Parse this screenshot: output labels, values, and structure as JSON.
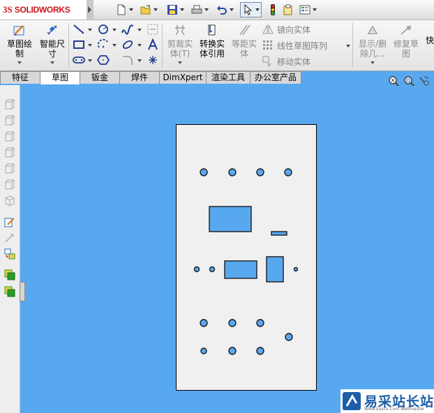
{
  "app": {
    "brand": "SOLIDWORKS",
    "brand_prefix": "3S"
  },
  "command_manager": {
    "sketch_label": "草图绘\n制",
    "smart_dim_label": "智能尺\n寸",
    "trim_label": "剪裁实\n体(T)",
    "convert_label": "转换实\n体引用",
    "offset_label": "等距实\n体",
    "mirror_label": "镜向实体",
    "linear_pattern_label": "线性草图阵列",
    "move_label": "移动实体",
    "show_delete_label": "显示/删\n除几...",
    "repair_label": "修复草\n图",
    "quick_label": "快"
  },
  "tabs": [
    {
      "label": "特征",
      "active": false
    },
    {
      "label": "草图",
      "active": true
    },
    {
      "label": "钣金",
      "active": false
    },
    {
      "label": "焊件",
      "active": false
    },
    {
      "label": "DimXpert",
      "active": false
    },
    {
      "label": "渲染工具",
      "active": false
    },
    {
      "label": "办公室产品",
      "active": false
    }
  ],
  "view_icons": [
    "zoom-to-fit-icon",
    "zoom-area-icon",
    "view-orientation-icon"
  ],
  "drawing": {
    "background_color": "#58a8f0",
    "plate_color": "#f0f0f0",
    "cutout_color": "#58a8f0"
  },
  "watermark": {
    "title": "易采站长站",
    "subtitle": "Www.Easck.Com Webmaster"
  }
}
